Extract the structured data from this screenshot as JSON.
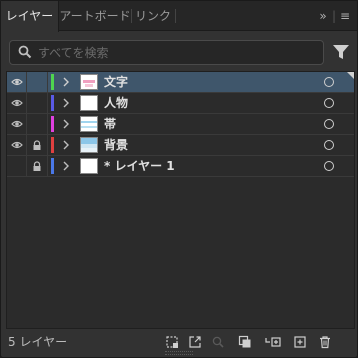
{
  "tabs": [
    {
      "label": "レイヤー",
      "active": true
    },
    {
      "label": "アートボード",
      "active": false
    },
    {
      "label": "リンク",
      "active": false
    }
  ],
  "tab_controls": {
    "collapse_glyph": "»",
    "menu_glyph": "≡"
  },
  "search": {
    "placeholder": "すべてを検索",
    "value": ""
  },
  "layers": [
    {
      "name": "文字",
      "visible": true,
      "locked": false,
      "color": "#4fd44f",
      "selected": true,
      "thumb": "pink-stroke"
    },
    {
      "name": "人物",
      "visible": true,
      "locked": false,
      "color": "#5a5ae6",
      "selected": false,
      "thumb": "blank"
    },
    {
      "name": "帯",
      "visible": true,
      "locked": false,
      "color": "#e040e0",
      "selected": false,
      "thumb": "light-blue-bands"
    },
    {
      "name": "背景",
      "visible": true,
      "locked": true,
      "color": "#e04040",
      "selected": false,
      "thumb": "sky"
    },
    {
      "name": "* レイヤー 1",
      "visible": false,
      "locked": true,
      "color": "#4a78e8",
      "selected": false,
      "thumb": "blank"
    }
  ],
  "footer": {
    "layer_count": "5 レイヤー"
  },
  "colors": {
    "panel_bg": "#323232",
    "selected_row": "#3f566b",
    "accent_text": "#e0e0e0"
  },
  "icons": [
    "search-icon",
    "filter-icon",
    "eye-icon",
    "lock-icon",
    "chevron-right-icon",
    "target-circle-icon",
    "collect-for-export-icon",
    "export-icon",
    "locate-object-icon",
    "make-clipping-mask-icon",
    "create-sublayer-icon",
    "create-new-layer-icon",
    "trash-icon"
  ]
}
